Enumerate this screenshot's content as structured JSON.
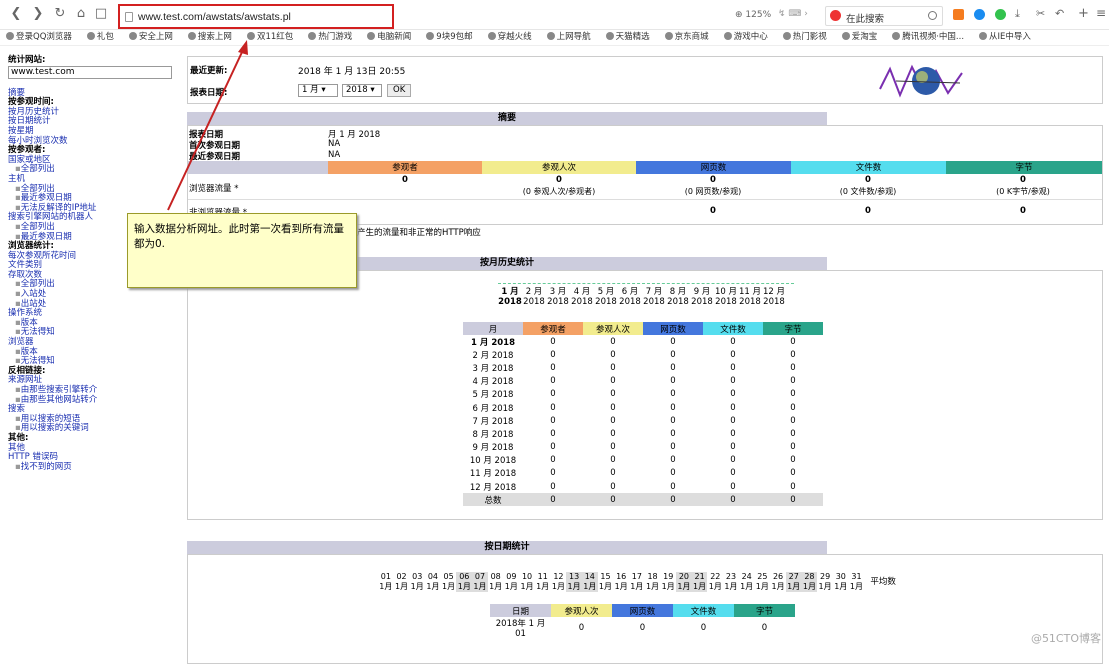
{
  "toolbar": {
    "url": "www.test.com/awstats/awstats.pl",
    "zoom": "125%",
    "search_placeholder": "在此搜索"
  },
  "bookmarks": [
    "登录QQ浏览器",
    "礼包",
    "安全上网",
    "搜索上网",
    "双11红包",
    "热门游戏",
    "电脑新闻",
    "9块9包邮",
    "穿越火线",
    "上网导航",
    "天猫精选",
    "京东商城",
    "游戏中心",
    "热门影视",
    "爱淘宝",
    "腾讯视频·中国...",
    "从IE中导入"
  ],
  "sidebar": {
    "site_label": "统计网站:",
    "site_value": "www.test.com",
    "items": [
      {
        "t": "link",
        "v": "摘要"
      },
      {
        "t": "head",
        "v": "按参观时间:"
      },
      {
        "t": "link",
        "v": "按月历史统计"
      },
      {
        "t": "link",
        "v": "按日期统计"
      },
      {
        "t": "link",
        "v": "按星期"
      },
      {
        "t": "link",
        "v": "每小时浏览次数"
      },
      {
        "t": "head",
        "v": "按参观者:"
      },
      {
        "t": "link",
        "v": "国家或地区"
      },
      {
        "t": "sub",
        "v": "全部列出"
      },
      {
        "t": "link",
        "v": "主机"
      },
      {
        "t": "sub",
        "v": "全部列出"
      },
      {
        "t": "sub",
        "v": "最近参观日期"
      },
      {
        "t": "sub",
        "v": "无法反解译的IP地址"
      },
      {
        "t": "link",
        "v": "搜索引擎网站的机器人"
      },
      {
        "t": "sub",
        "v": "全部列出"
      },
      {
        "t": "sub",
        "v": "最近参观日期"
      },
      {
        "t": "head",
        "v": "浏览器统计:"
      },
      {
        "t": "link",
        "v": "每次参观所花时间"
      },
      {
        "t": "link",
        "v": "文件类别"
      },
      {
        "t": "link",
        "v": "存取次数"
      },
      {
        "t": "sub",
        "v": "全部列出"
      },
      {
        "t": "sub",
        "v": "入站处"
      },
      {
        "t": "sub",
        "v": "出站处"
      },
      {
        "t": "link",
        "v": "操作系统"
      },
      {
        "t": "sub",
        "v": "版本"
      },
      {
        "t": "sub",
        "v": "无法得知"
      },
      {
        "t": "link",
        "v": "浏览器"
      },
      {
        "t": "sub",
        "v": "版本"
      },
      {
        "t": "sub",
        "v": "无法得知"
      },
      {
        "t": "head",
        "v": "反相链接:"
      },
      {
        "t": "link",
        "v": "来源网址"
      },
      {
        "t": "sub",
        "v": "由那些搜索引擎转介"
      },
      {
        "t": "sub",
        "v": "由那些其他网站转介"
      },
      {
        "t": "link",
        "v": "搜索"
      },
      {
        "t": "sub",
        "v": "用以搜索的短语"
      },
      {
        "t": "sub",
        "v": "用以搜索的关键词"
      },
      {
        "t": "head",
        "v": "其他:"
      },
      {
        "t": "link",
        "v": "其他"
      },
      {
        "t": "link",
        "v": "HTTP 错误码"
      },
      {
        "t": "sub",
        "v": "找不到的网页"
      }
    ]
  },
  "header": {
    "last_update_label": "最近更新:",
    "last_update_value": "2018 年 1 月 13日 20:55",
    "report_date_label": "报表日期:",
    "month_select": "1 月",
    "year_select": "2018",
    "ok_label": "OK"
  },
  "summary": {
    "title": "摘要",
    "row1_label": "报表日期",
    "row1_value": "月 1 月 2018",
    "row2_label": "首次参观日期",
    "row2_value": "NA",
    "row3_label": "最近参观日期",
    "row3_value": "NA",
    "col_headers": [
      "参观者",
      "参观人次",
      "网页数",
      "文件数",
      "字节"
    ],
    "traffic_label": "浏览器流量 *",
    "traffic_values": [
      "0",
      "0",
      "0",
      "0",
      "0"
    ],
    "traffic_sub": [
      "",
      "(0 参观人次/参观者)",
      "(0 网页数/参观)",
      "(0 文件数/参观)",
      "(0 K字节/参观)"
    ],
    "nontraffic_label": "非浏览器流量 *",
    "nontraffic_values": [
      "",
      "",
      "0",
      "0",
      "0"
    ],
    "footnote": "产生的流量和非正常的HTTP响应"
  },
  "annotation": "输入数据分析网址。此时第一次看到所有流量都为0.",
  "monthly": {
    "title": "按月历史统计",
    "months": [
      "1 月",
      "2 月",
      "3 月",
      "4 月",
      "5 月",
      "6 月",
      "7 月",
      "8 月",
      "9 月",
      "10 月",
      "11 月",
      "12 月"
    ],
    "year": "2018",
    "col_headers": [
      "月",
      "参观者",
      "参观人次",
      "网页数",
      "文件数",
      "字节"
    ],
    "rows": [
      [
        "1 月 2018",
        "0",
        "0",
        "0",
        "0",
        "0"
      ],
      [
        "2 月 2018",
        "0",
        "0",
        "0",
        "0",
        "0"
      ],
      [
        "3 月 2018",
        "0",
        "0",
        "0",
        "0",
        "0"
      ],
      [
        "4 月 2018",
        "0",
        "0",
        "0",
        "0",
        "0"
      ],
      [
        "5 月 2018",
        "0",
        "0",
        "0",
        "0",
        "0"
      ],
      [
        "6 月 2018",
        "0",
        "0",
        "0",
        "0",
        "0"
      ],
      [
        "7 月 2018",
        "0",
        "0",
        "0",
        "0",
        "0"
      ],
      [
        "8 月 2018",
        "0",
        "0",
        "0",
        "0",
        "0"
      ],
      [
        "9 月 2018",
        "0",
        "0",
        "0",
        "0",
        "0"
      ],
      [
        "10 月 2018",
        "0",
        "0",
        "0",
        "0",
        "0"
      ],
      [
        "11 月 2018",
        "0",
        "0",
        "0",
        "0",
        "0"
      ],
      [
        "12 月 2018",
        "0",
        "0",
        "0",
        "0",
        "0"
      ]
    ],
    "total_label": "总数",
    "total_values": [
      "0",
      "0",
      "0",
      "0",
      "0"
    ]
  },
  "daily": {
    "title": "按日期统计",
    "days": [
      "01",
      "02",
      "03",
      "04",
      "05",
      "06",
      "07",
      "08",
      "09",
      "10",
      "11",
      "12",
      "13",
      "14",
      "15",
      "16",
      "17",
      "18",
      "19",
      "20",
      "21",
      "22",
      "23",
      "24",
      "25",
      "26",
      "27",
      "28",
      "29",
      "30",
      "31"
    ],
    "month_label": "1月",
    "avg_label": "平均数",
    "col_headers": [
      "日期",
      "参观人次",
      "网页数",
      "文件数",
      "字节"
    ],
    "row": [
      "2018年 1 月 01",
      "0",
      "0",
      "0",
      "0"
    ]
  },
  "watermark": "@51CTO博客"
}
